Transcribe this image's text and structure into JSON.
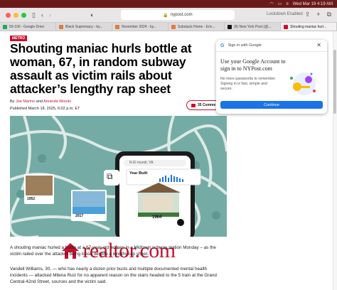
{
  "menubar": {
    "datetime": "Wed Mar 19  4:19 AM"
  },
  "browser": {
    "url": "nypost.com",
    "lockdown": "Lockdown Enabled",
    "tabs": [
      {
        "label": "50-100 - Google Drive",
        "favicon_color": "#1fa463"
      },
      {
        "label": "Black Supremacy - by...",
        "favicon_color": "#e07b39"
      },
      {
        "label": "November 2024 - by...",
        "favicon_color": "#e07b39"
      },
      {
        "label": "Substack Home - Eric...",
        "favicon_color": "#e07b39"
      },
      {
        "label": "(8) New York Post (@...",
        "favicon_color": "#111111"
      },
      {
        "label": "Shouting maniac hurl...",
        "favicon_color": "#c8102e",
        "active": true
      }
    ]
  },
  "article": {
    "section": "METRO",
    "headline": "Shouting maniac hurls bottle at woman, 67, in random subway assault as victim rails about attacker’s lengthy rap sheet",
    "by_prefix": "By ",
    "author1": "Joe Marino",
    "by_and": " and ",
    "author2": "Amanda Woods",
    "published": "Published March 18, 2025, 6:02 p.m. ET",
    "comments": "35 Comme",
    "paragraph1": "A shouting maniac hurled a bottle at a 67-year-old woman in a Midtown subway station Monday – as the victim railed over the attacker being loose despite a lengthy rap sheet.",
    "paragraph2": "Vandell Williams, 30, — who has nearly a dozen prior busts and multiple documented mental health incidents — attacked Milena Ruiz for no apparent reason on the stairs headed to the 5 train at the Grand Central-42nd Street, sources and the victim said."
  },
  "ad": {
    "search_placeholder": "N El mundi, VA",
    "card_label": "Year Built",
    "card_year": "1964",
    "house1_year": "1952",
    "house2_year": "2017",
    "brand": "realtor.com"
  },
  "google_popup": {
    "header": "Sign in with Google",
    "title": "Use your Google Account to sign in to NYPost.com",
    "body": "No more passwords to remember. Signing in is fast, simple and secure.",
    "button": "Continue"
  },
  "colors": {
    "brand_red": "#c8102e",
    "google_blue": "#1a73e8",
    "menubar": "#6b1a1a"
  }
}
